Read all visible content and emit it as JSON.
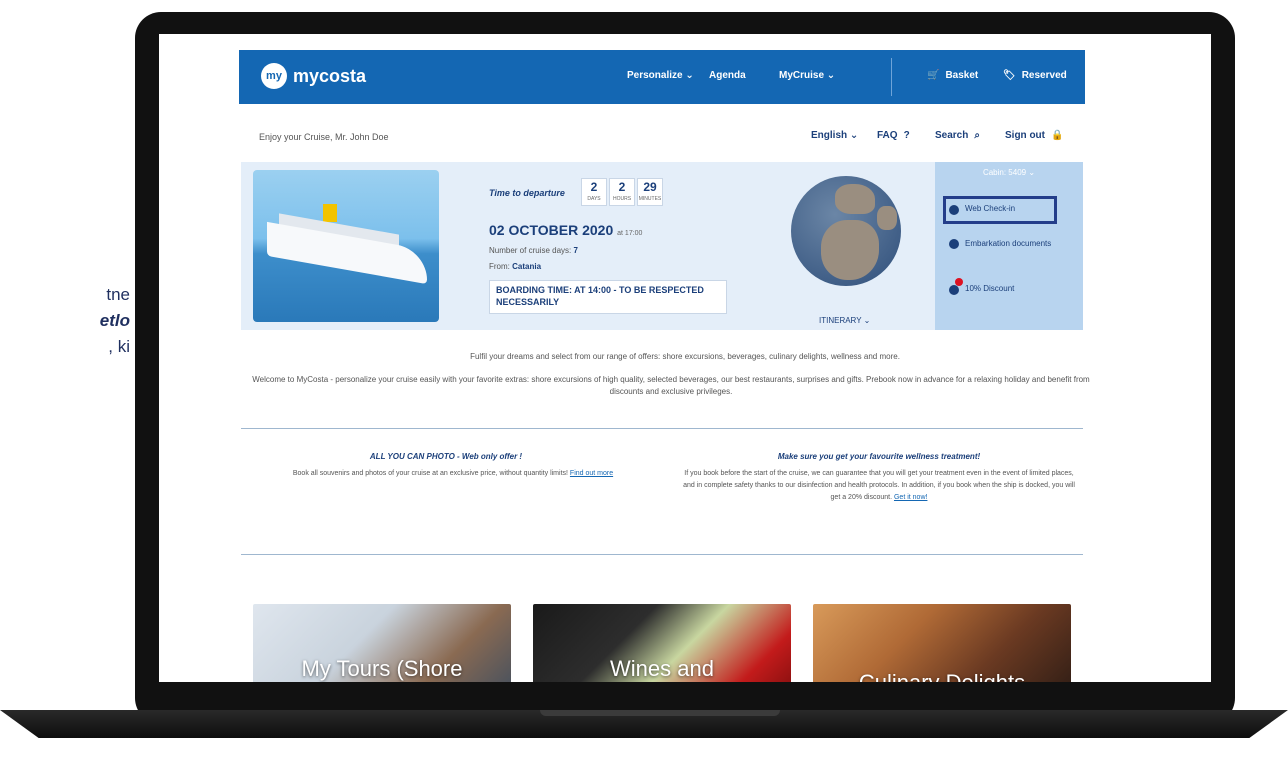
{
  "slide_text": {
    "line1": "tne",
    "line2": "etlo",
    "line3": ", ki"
  },
  "nav": {
    "logo_icon": "my",
    "logo_text": "mycosta",
    "personalize": "Personalize ⌄",
    "agenda": "Agenda",
    "mycruise": "MyCruise ⌄",
    "basket": "Basket",
    "reserved": "Reserved"
  },
  "subheader": {
    "greeting": "Enjoy your Cruise, Mr. John Doe",
    "language": "English ⌄",
    "faq": "FAQ",
    "search": "Search",
    "signout": "Sign out"
  },
  "hero": {
    "countdown_label": "Time to departure",
    "countdown": [
      {
        "value": "2",
        "unit": "DAYS"
      },
      {
        "value": "2",
        "unit": "HOURS"
      },
      {
        "value": "29",
        "unit": "MINUTES"
      }
    ],
    "date": "02 OCTOBER 2020",
    "time": "at 17:00",
    "days_label": "Number of cruise days:",
    "days_value": "7",
    "from_label": "From:",
    "from_value": "Catania",
    "boarding": "BOARDING TIME: AT 14:00 - TO BE RESPECTED NECESSARILY",
    "itinerary": "ITINERARY ⌄"
  },
  "side": {
    "cabin": "Cabin: 5409 ⌄",
    "webcheckin": "Web Check-in",
    "embarkation": "Embarkation documents",
    "discount": "10% Discount"
  },
  "intro": {
    "line1": "Fulfil your dreams and select from our range of offers: shore excursions, beverages, culinary delights, wellness and more.",
    "line2": "Welcome to MyCosta - personalize your cruise easily with your favorite extras: shore excursions of high quality, selected beverages, our best restaurants, surprises and gifts. Prebook now in advance for a relaxing holiday and benefit from discounts and exclusive privileges."
  },
  "promo": {
    "left_title": "ALL YOU CAN PHOTO - Web only offer !",
    "left_text": "Book all souvenirs and photos of your cruise at an exclusive price, without quantity limits!",
    "left_link": "Find out more",
    "right_title": "Make sure you get your favourite wellness treatment!",
    "right_text": "If you book before the start of the cruise, we can guarantee that you will get your treatment even in the event of limited places, and in complete safety thanks to our disinfection and health protocols. In addition, if you book when the ship is docked, you will get a 20% discount.",
    "right_link": "Get it now!"
  },
  "cards": [
    {
      "title": "My Tours (Shore"
    },
    {
      "title": "Wines and"
    },
    {
      "title": "Culinary Delights"
    }
  ],
  "colors": {
    "brand_blue": "#1467b3",
    "dark_blue": "#1b3f7a",
    "highlight": "#233d8a"
  }
}
